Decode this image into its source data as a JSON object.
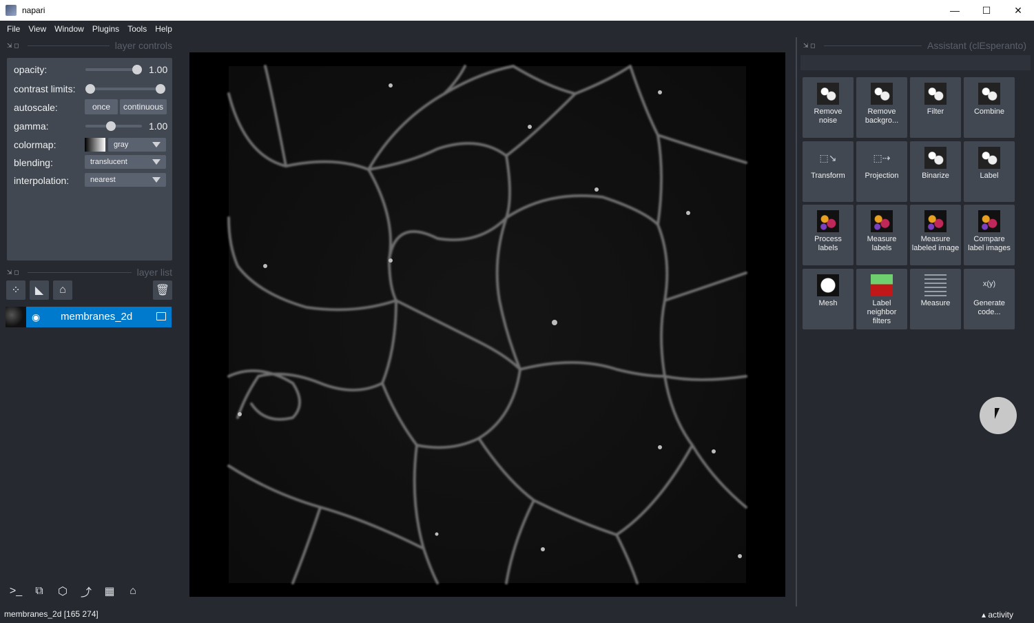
{
  "window": {
    "title": "napari",
    "minimize": "—",
    "maximize": "☐",
    "close": "✕"
  },
  "menu": [
    "File",
    "View",
    "Window",
    "Plugins",
    "Tools",
    "Help"
  ],
  "layer_controls": {
    "header": "layer controls",
    "opacity_label": "opacity:",
    "opacity_value": "1.00",
    "contrast_label": "contrast limits:",
    "autoscale_label": "autoscale:",
    "once_label": "once",
    "continuous_label": "continuous",
    "gamma_label": "gamma:",
    "gamma_value": "1.00",
    "colormap_label": "colormap:",
    "colormap_value": "gray",
    "blending_label": "blending:",
    "blending_value": "translucent",
    "interpolation_label": "interpolation:",
    "interpolation_value": "nearest"
  },
  "layer_list": {
    "header": "layer list",
    "layers": [
      {
        "name": "membranes_2d"
      }
    ]
  },
  "assistant": {
    "header": "Assistant (clEsperanto)",
    "tiles": [
      {
        "label": "Remove noise"
      },
      {
        "label": "Remove backgro..."
      },
      {
        "label": "Filter"
      },
      {
        "label": "Combine"
      },
      {
        "label": "Transform"
      },
      {
        "label": "Projection"
      },
      {
        "label": "Binarize"
      },
      {
        "label": "Label"
      },
      {
        "label": "Process labels"
      },
      {
        "label": "Measure labels"
      },
      {
        "label": "Measure labeled image"
      },
      {
        "label": "Compare label images"
      },
      {
        "label": "Mesh"
      },
      {
        "label": "Label neighbor filters"
      },
      {
        "label": "Measure"
      },
      {
        "label": "Generate code..."
      }
    ],
    "generate_code_glyph": "x(y)"
  },
  "status": {
    "text": "membranes_2d [165 274]",
    "activity": "activity"
  }
}
